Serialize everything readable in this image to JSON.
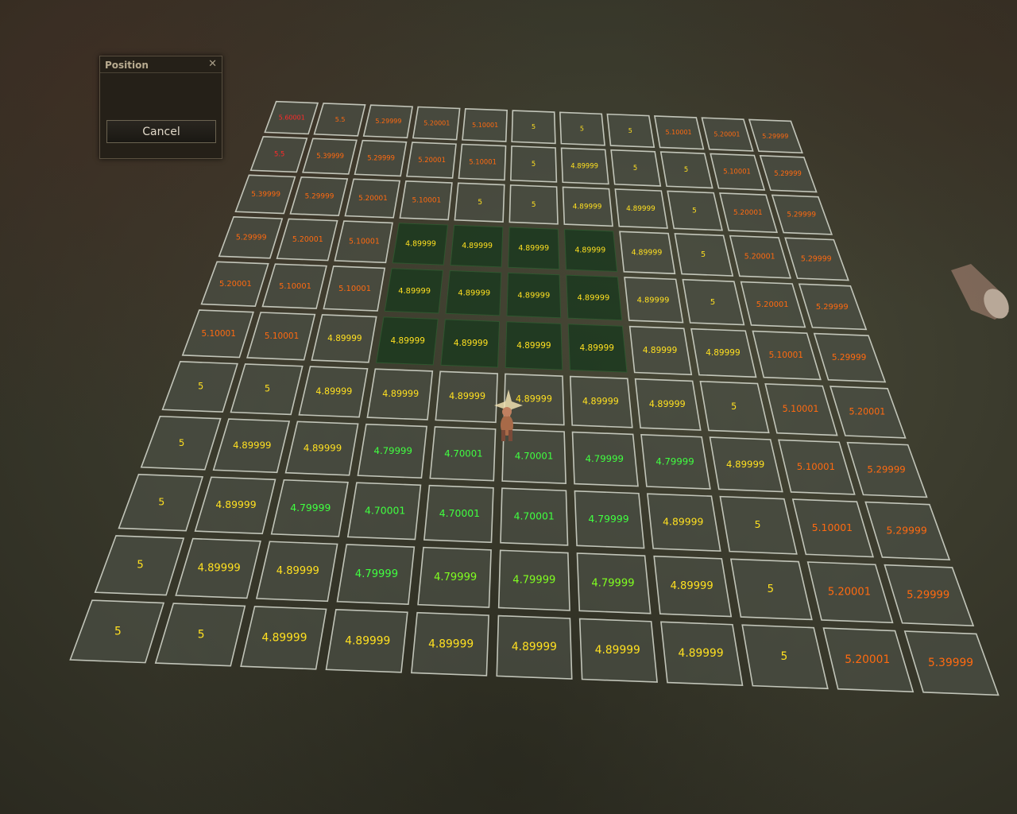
{
  "dialog": {
    "title": "Position",
    "cancel_label": "Cancel",
    "close_icon": "close-icon"
  },
  "colors": {
    "red": "#ff2a2a",
    "orange": "#ff6a10",
    "dark_orange": "#ff8c20",
    "yellow": "#ffe020",
    "green": "#40ff40",
    "light_green": "#80ff20",
    "tile_fill": "#4b4f44",
    "tile_border": "#d8dcd0",
    "selected_fill": "#1e3a20"
  },
  "grid": {
    "rows": 11,
    "cols": 11,
    "values": [
      [
        "5.60001",
        "5.5",
        "5.29999",
        "5.20001",
        "5.10001",
        "5",
        "5",
        "5",
        "5.10001",
        "5.20001",
        "5.29999"
      ],
      [
        "5.5",
        "5.39999",
        "5.29999",
        "5.20001",
        "5.10001",
        "5",
        "4.89999",
        "5",
        "5",
        "5.10001",
        "5.29999"
      ],
      [
        "5.39999",
        "5.29999",
        "5.20001",
        "5.10001",
        "5",
        "5",
        "4.89999",
        "4.89999",
        "5",
        "5.20001",
        "5.29999"
      ],
      [
        "5.29999",
        "5.20001",
        "5.10001",
        "4.89999",
        "4.89999",
        "4.89999",
        "4.89999",
        "4.89999",
        "5",
        "5.20001",
        "5.29999"
      ],
      [
        "5.20001",
        "5.10001",
        "5.10001",
        "4.89999",
        "4.89999",
        "4.89999",
        "4.89999",
        "4.89999",
        "5",
        "5.20001",
        "5.29999"
      ],
      [
        "5.10001",
        "5.10001",
        "4.89999",
        "4.89999",
        "4.89999",
        "4.89999",
        "4.89999",
        "4.89999",
        "4.89999",
        "5.10001",
        "5.29999"
      ],
      [
        "5",
        "5",
        "4.89999",
        "4.89999",
        "4.89999",
        "4.89999",
        "4.89999",
        "4.89999",
        "5",
        "5.10001",
        "5.20001"
      ],
      [
        "5",
        "4.89999",
        "4.89999",
        "4.79999",
        "4.70001",
        "4.70001",
        "4.79999",
        "4.79999",
        "4.89999",
        "5.10001",
        "5.29999"
      ],
      [
        "5",
        "4.89999",
        "4.79999",
        "4.70001",
        "4.70001",
        "4.70001",
        "4.79999",
        "4.89999",
        "5",
        "5.10001",
        "5.29999"
      ],
      [
        "5",
        "4.89999",
        "4.89999",
        "4.79999",
        "4.79999",
        "4.79999",
        "4.79999",
        "4.89999",
        "5",
        "5.20001",
        "5.29999"
      ],
      [
        "5",
        "5",
        "4.89999",
        "4.89999",
        "4.89999",
        "4.89999",
        "4.89999",
        "4.89999",
        "5",
        "5.20001",
        "5.39999"
      ]
    ],
    "colors": [
      [
        "red",
        "orange",
        "orange",
        "orange",
        "orange",
        "yellow",
        "yellow",
        "yellow",
        "orange",
        "orange",
        "orange"
      ],
      [
        "red",
        "orange",
        "orange",
        "orange",
        "orange",
        "yellow",
        "yellow",
        "yellow",
        "yellow",
        "orange",
        "orange"
      ],
      [
        "orange",
        "orange",
        "orange",
        "orange",
        "yellow",
        "yellow",
        "yellow",
        "yellow",
        "yellow",
        "orange",
        "orange"
      ],
      [
        "orange",
        "orange",
        "orange",
        "yellow",
        "yellow",
        "yellow",
        "yellow",
        "yellow",
        "yellow",
        "orange",
        "orange"
      ],
      [
        "orange",
        "orange",
        "orange",
        "yellow",
        "yellow",
        "yellow",
        "yellow",
        "yellow",
        "yellow",
        "orange",
        "orange"
      ],
      [
        "orange",
        "orange",
        "yellow",
        "yellow",
        "yellow",
        "yellow",
        "yellow",
        "yellow",
        "yellow",
        "orange",
        "orange"
      ],
      [
        "yellow",
        "yellow",
        "yellow",
        "yellow",
        "yellow",
        "yellow",
        "yellow",
        "yellow",
        "yellow",
        "orange",
        "orange"
      ],
      [
        "yellow",
        "yellow",
        "yellow",
        "green",
        "green",
        "green",
        "green",
        "green",
        "yellow",
        "orange",
        "orange"
      ],
      [
        "yellow",
        "yellow",
        "green",
        "green",
        "green",
        "green",
        "green",
        "yellow",
        "yellow",
        "orange",
        "orange"
      ],
      [
        "yellow",
        "yellow",
        "yellow",
        "green",
        "light_green",
        "light_green",
        "light_green",
        "yellow",
        "yellow",
        "orange",
        "orange"
      ],
      [
        "yellow",
        "yellow",
        "yellow",
        "yellow",
        "yellow",
        "yellow",
        "yellow",
        "yellow",
        "yellow",
        "orange",
        "orange"
      ]
    ],
    "selected_region": {
      "row_start": 3,
      "row_end": 6,
      "col_start": 3,
      "col_end": 6
    },
    "player_marker": "player-character-icon"
  }
}
